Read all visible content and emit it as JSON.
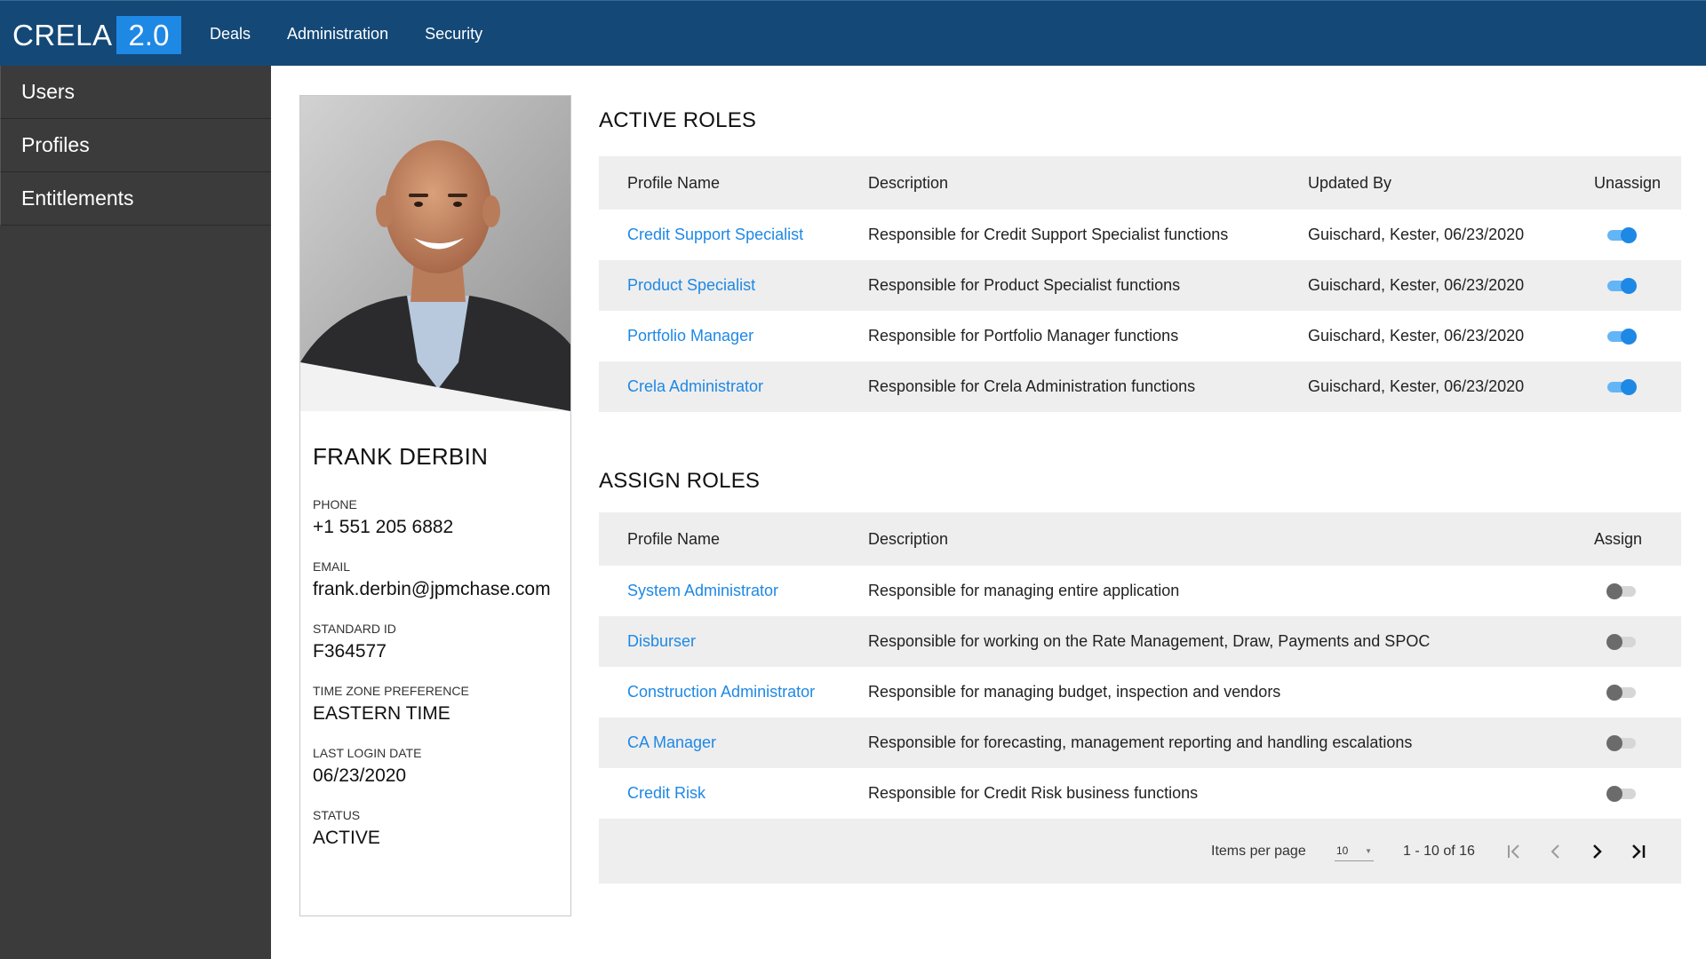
{
  "app": {
    "name": "CRELA",
    "version": "2.0"
  },
  "nav": [
    "Deals",
    "Administration",
    "Security"
  ],
  "sidebar": [
    "Users",
    "Profiles",
    "Entitlements"
  ],
  "profile": {
    "name": "FRANK DERBIN",
    "fields": [
      {
        "label": "PHONE",
        "value": "+1 551 205 6882"
      },
      {
        "label": "EMAIL",
        "value": "frank.derbin@jpmchase.com"
      },
      {
        "label": "STANDARD ID",
        "value": "F364577"
      },
      {
        "label": "TIME ZONE PREFERENCE",
        "value": "EASTERN TIME"
      },
      {
        "label": "LAST LOGIN DATE",
        "value": "06/23/2020"
      },
      {
        "label": "STATUS",
        "value": "ACTIVE"
      }
    ]
  },
  "active_roles": {
    "title": "ACTIVE ROLES",
    "headers": {
      "name": "Profile Name",
      "description": "Description",
      "updated_by": "Updated By",
      "action": "Unassign"
    },
    "rows": [
      {
        "name": "Credit Support Specialist",
        "description": "Responsible for Credit Support Specialist functions",
        "updated_by": "Guischard, Kester, 06/23/2020",
        "on": true
      },
      {
        "name": "Product Specialist",
        "description": "Responsible for Product Specialist functions",
        "updated_by": "Guischard, Kester, 06/23/2020",
        "on": true
      },
      {
        "name": "Portfolio Manager",
        "description": "Responsible for Portfolio Manager functions",
        "updated_by": "Guischard, Kester, 06/23/2020",
        "on": true
      },
      {
        "name": "Crela Administrator",
        "description": "Responsible for Crela Administration functions",
        "updated_by": "Guischard, Kester, 06/23/2020",
        "on": true
      }
    ]
  },
  "assign_roles": {
    "title": "ASSIGN ROLES",
    "headers": {
      "name": "Profile Name",
      "description": "Description",
      "action": "Assign"
    },
    "rows": [
      {
        "name": "System Administrator",
        "description": "Responsible for managing entire application",
        "on": false
      },
      {
        "name": "Disburser",
        "description": "Responsible for working on the Rate Management, Draw, Payments and SPOC",
        "on": false
      },
      {
        "name": "Construction Administrator",
        "description": "Responsible for managing budget, inspection and vendors",
        "on": false
      },
      {
        "name": "CA Manager",
        "description": "Responsible for forecasting, management reporting and handling escalations",
        "on": false
      },
      {
        "name": "Credit Risk",
        "description": "Responsible for Credit Risk business functions",
        "on": false
      }
    ]
  },
  "pagination": {
    "items_per_page_label": "Items per page",
    "items_per_page": "10",
    "range": "1 - 10 of 16",
    "icons": [
      "first-page-icon",
      "previous-page-icon",
      "next-page-icon",
      "last-page-icon"
    ]
  },
  "colors": {
    "topbar": "#144877",
    "accent": "#1e88e5",
    "sidebar": "#3b3b3b",
    "table_header": "#eeeeee"
  }
}
